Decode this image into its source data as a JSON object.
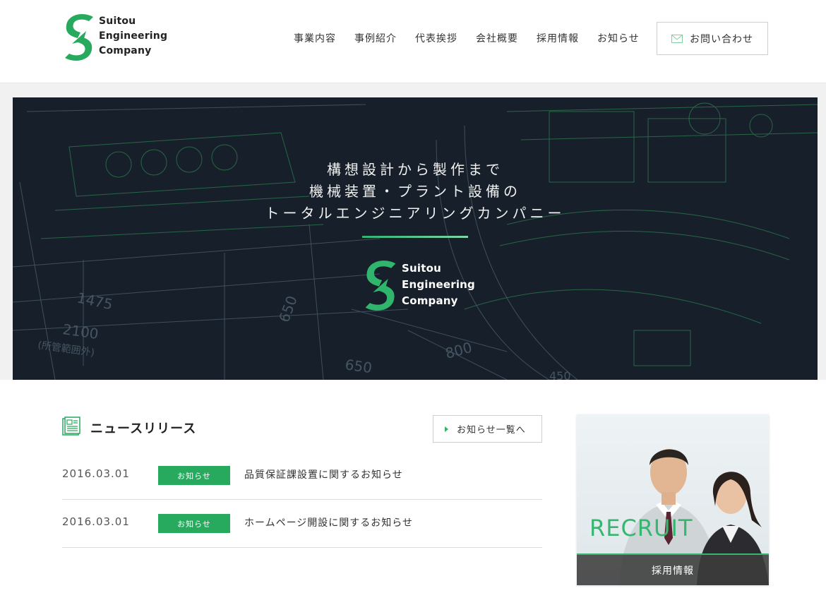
{
  "header": {
    "logo": {
      "line1": "Suitou",
      "line2": "Engineering",
      "line3": "Company"
    },
    "nav": [
      "事業内容",
      "事例紹介",
      "代表挨拶",
      "会社概要",
      "採用情報",
      "お知らせ"
    ],
    "contact_label": "お問い合わせ",
    "contact_icon": "mail-icon"
  },
  "hero": {
    "lines": [
      "構想設計から製作まで",
      "機械装置・プラント設備の",
      "トータルエンジニアリングカンパニー"
    ],
    "logo": {
      "line1": "Suitou",
      "line2": "Engineering",
      "line3": "Company"
    },
    "drawing_labels": [
      "1475",
      "2100",
      "(所管範囲外)",
      "650",
      "800",
      "650",
      "450"
    ]
  },
  "news": {
    "title": "ニュースリリース",
    "more_label": "お知らせ一覧へ",
    "items": [
      {
        "date": "2016.03.01",
        "category": "お知らせ",
        "title": "品質保証課設置に関するお知らせ"
      },
      {
        "date": "2016.03.01",
        "category": "お知らせ",
        "title": "ホームページ開設に関するお知らせ"
      }
    ]
  },
  "recruit": {
    "word": "RECRUIT",
    "label": "採用情報"
  },
  "colors": {
    "brand_green": "#27a95e",
    "hero_bg": "#17202a",
    "text": "#333333"
  }
}
